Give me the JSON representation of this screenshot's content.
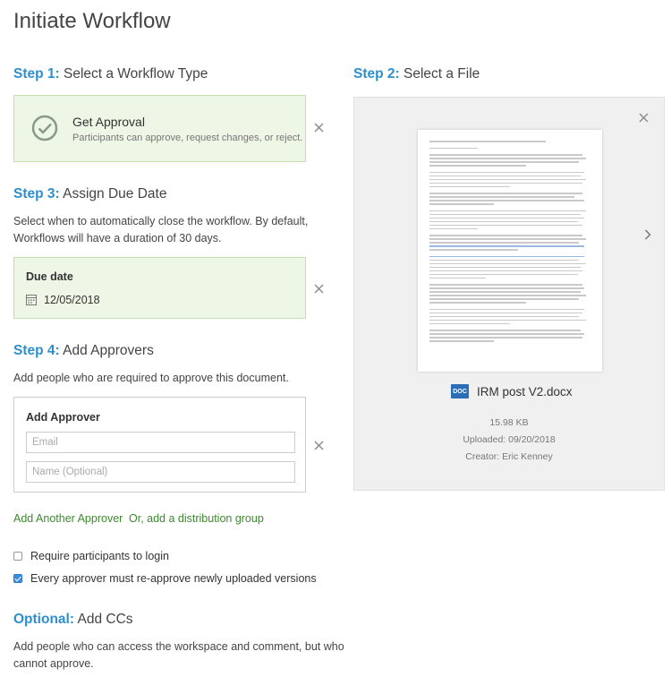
{
  "page": {
    "title": "Initiate Workflow"
  },
  "step1": {
    "num": "Step 1:",
    "label": "Select a Workflow Type",
    "type_title": "Get Approval",
    "type_desc": "Participants can approve, request changes, or reject."
  },
  "step2": {
    "num": "Step 2:",
    "label": "Select a File",
    "file": {
      "badge": "DOC",
      "name": "IRM post V2.docx",
      "size": "15.98 KB",
      "uploaded": "Uploaded: 09/20/2018",
      "creator": "Creator: Eric Kenney"
    }
  },
  "step3": {
    "num": "Step 3:",
    "label": "Assign Due Date",
    "desc_line1": "Select when to automatically close the workflow. By default,",
    "desc_line2": "Workflows will have a duration of 30 days.",
    "due_label": "Due date",
    "due_value": "12/05/2018"
  },
  "step4": {
    "num": "Step 4:",
    "label": "Add Approvers",
    "desc": "Add people who are required to approve this document.",
    "box_title": "Add Approver",
    "email_placeholder": "Email",
    "name_placeholder": "Name (Optional)",
    "add_another": "Add Another Approver",
    "add_group": "Or, add a distribution group"
  },
  "options": {
    "require_login": {
      "label": "Require participants to login",
      "checked": false
    },
    "reapprove": {
      "label": "Every approver must re-approve newly uploaded versions",
      "checked": true
    }
  },
  "optional": {
    "num": "Optional:",
    "label": "Add CCs",
    "desc_line1": "Add people who can access the workspace and comment, but who",
    "desc_line2": "cannot approve."
  },
  "colors": {
    "accent_blue": "#2f8fcd",
    "link_green": "#3c8a2e",
    "panel_green": "#eef6e6"
  },
  "icons": {
    "approval": "check-circle-icon",
    "calendar": "calendar-icon",
    "close": "close-icon",
    "next": "chevron-right-icon"
  }
}
